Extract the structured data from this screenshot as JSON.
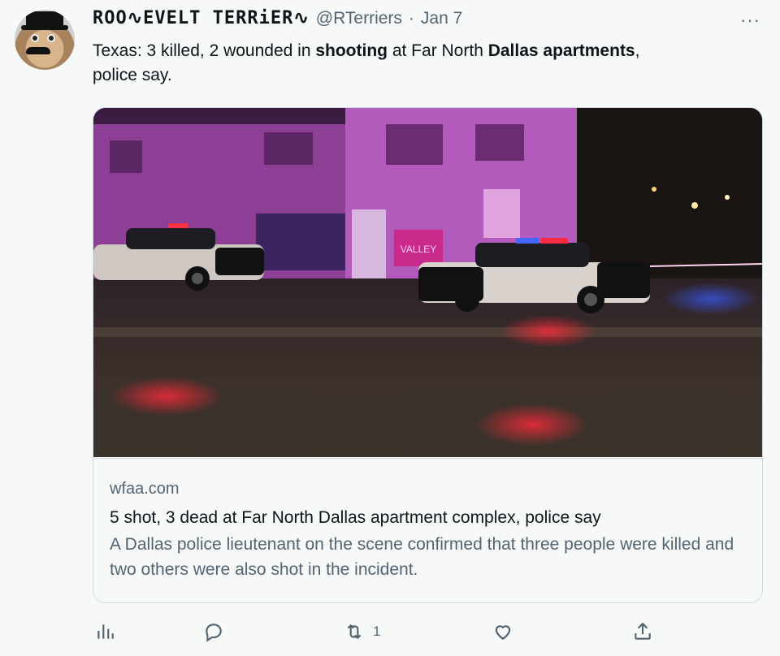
{
  "tweet": {
    "display_name": "ROO∿EVELT TERRiER∿",
    "handle": "@RTerriers",
    "separator": "·",
    "date": "Jan 7",
    "more_label": "···",
    "text": {
      "p1": "Texas: 3 killed, 2 wounded in ",
      "b1": "shooting",
      "p2": " at Far North ",
      "b2": "Dallas apartments",
      "p3": ",",
      "p4": "police say."
    }
  },
  "card": {
    "image_alt": "Police cars at night outside an apartment complex",
    "image_sign_text": "VALLEY",
    "domain": "wfaa.com",
    "title": "5 shot, 3 dead at Far North Dallas apartment complex, police say",
    "description": "A Dallas police lieutenant on the scene confirmed that three people were killed and two others were also shot in the incident."
  },
  "actions": {
    "retweet_count": "1",
    "icons": [
      "analytics-icon",
      "reply-icon",
      "retweet-icon",
      "like-icon",
      "share-icon"
    ]
  },
  "colors": {
    "background": "#f7f9f9",
    "text": "#0f1419",
    "secondary": "#536471",
    "border": "#cfd9de"
  }
}
